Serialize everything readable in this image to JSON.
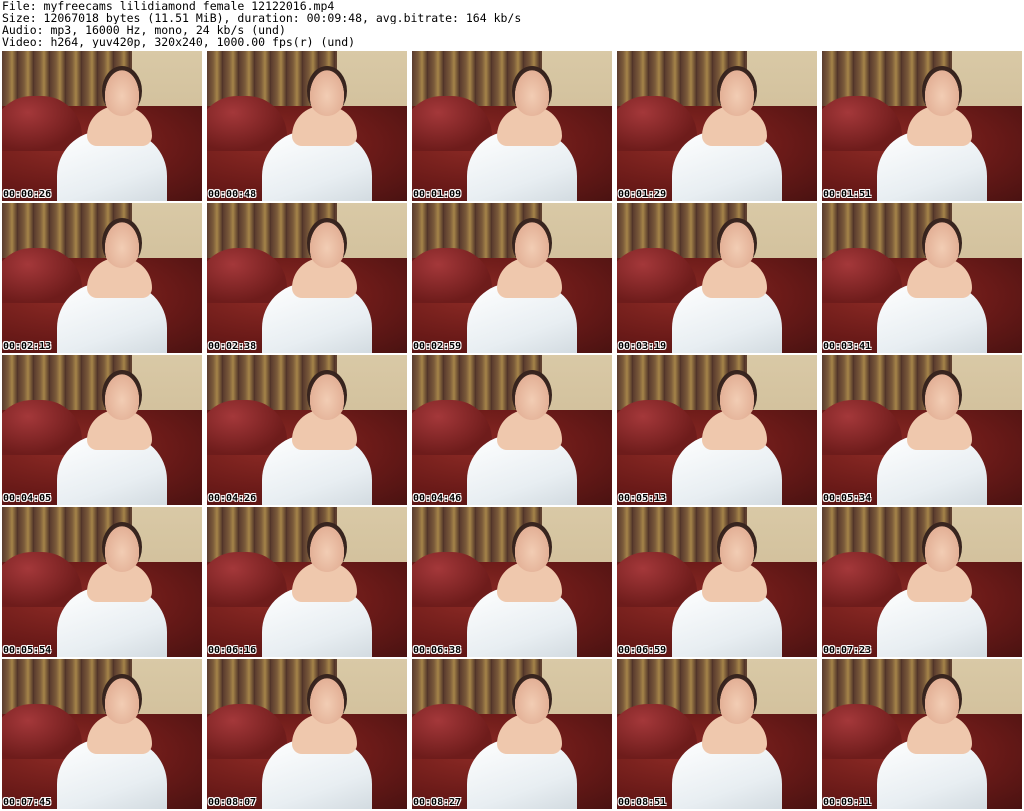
{
  "header": {
    "file_line": "File: myfreecams_lilidiamond_female_12122016.mp4",
    "size_line": "Size: 12067018 bytes (11.51 MiB), duration: 00:09:48, avg.bitrate: 164 kb/s",
    "audio_line": "Audio: mp3, 16000 Hz, mono, 24 kb/s (und)",
    "video_line": "Video: h264, yuv420p, 320x240, 1000.00 fps(r) (und)"
  },
  "thumbnails": [
    {
      "timestamp": "00:00:26"
    },
    {
      "timestamp": "00:00:48"
    },
    {
      "timestamp": "00:01:09"
    },
    {
      "timestamp": "00:01:29"
    },
    {
      "timestamp": "00:01:51"
    },
    {
      "timestamp": "00:02:13"
    },
    {
      "timestamp": "00:02:38"
    },
    {
      "timestamp": "00:02:59"
    },
    {
      "timestamp": "00:03:19"
    },
    {
      "timestamp": "00:03:41"
    },
    {
      "timestamp": "00:04:05"
    },
    {
      "timestamp": "00:04:26"
    },
    {
      "timestamp": "00:04:46"
    },
    {
      "timestamp": "00:05:13"
    },
    {
      "timestamp": "00:05:34"
    },
    {
      "timestamp": "00:05:54"
    },
    {
      "timestamp": "00:06:16"
    },
    {
      "timestamp": "00:06:38"
    },
    {
      "timestamp": "00:06:59"
    },
    {
      "timestamp": "00:07:23"
    },
    {
      "timestamp": "00:07:45"
    },
    {
      "timestamp": "00:08:07"
    },
    {
      "timestamp": "00:08:27"
    },
    {
      "timestamp": "00:08:51"
    },
    {
      "timestamp": "00:09:11"
    }
  ]
}
